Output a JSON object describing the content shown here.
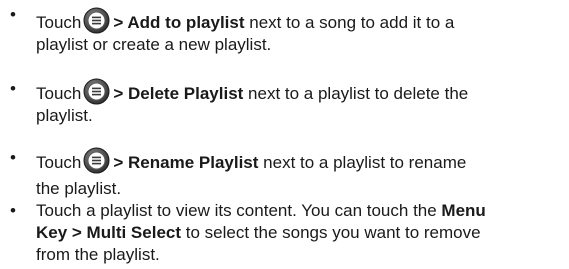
{
  "bullet": "•",
  "icon": "menu-icon",
  "items": [
    {
      "l1_pre": "Touch",
      "l1_bold": "> Add to playlist",
      "l1_post": " next to a song to add it to a",
      "l2": "playlist or create a new playlist."
    },
    {
      "l1_pre": "Touch",
      "l1_bold": "> Delete Playlist",
      "l1_post": " next to a playlist to delete the",
      "l2": "playlist."
    },
    {
      "l1_pre": "Touch",
      "l1_bold": "> Rename Playlist",
      "l1_post": " next to a playlist to rename",
      "l2": "the playlist."
    },
    {
      "l1_pre": "Touch a playlist to view its content. You can touch the ",
      "l1_bold": "Menu",
      "l2_bold": "Key > Multi Select",
      "l2_post": " to select the songs you want to remove",
      "l3": "from the playlist."
    }
  ]
}
